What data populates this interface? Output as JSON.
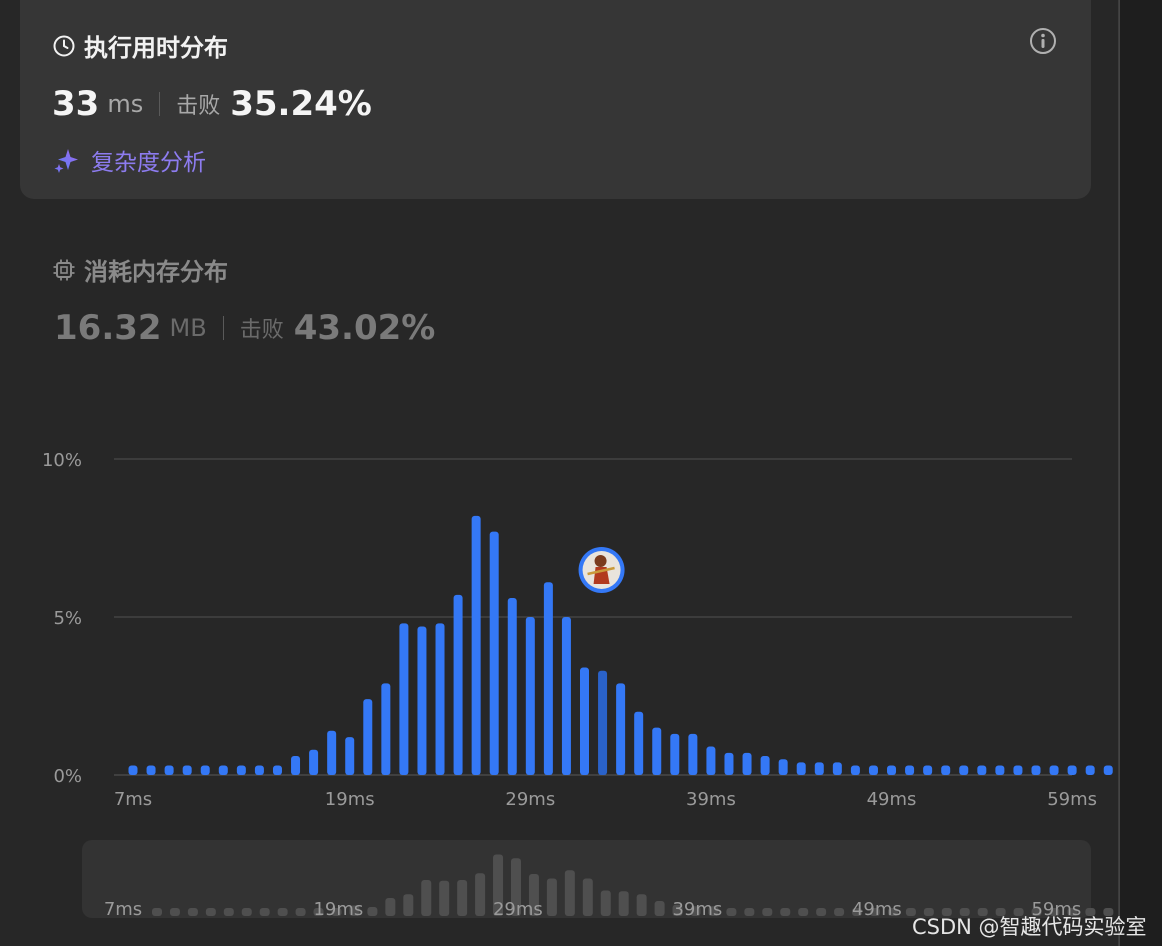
{
  "runtime": {
    "title": "执行用时分布",
    "value": "33",
    "unit": "ms",
    "beat_label": "击败",
    "beat_percent": "35.24%",
    "complexity_link": "复杂度分析"
  },
  "memory": {
    "title": "消耗内存分布",
    "value": "16.32",
    "unit": "MB",
    "beat_label": "击败",
    "beat_percent": "43.02%"
  },
  "colors": {
    "accent": "#3478f6",
    "accent_dim": "#2a62c9",
    "card": "#363636",
    "background": "#272727",
    "link": "#8d7cf0"
  },
  "icons": {
    "runtime_title": "clock-icon",
    "info": "info-icon",
    "complexity": "sparkle-icon",
    "memory_title": "chip-icon",
    "user_marker": "avatar"
  },
  "chart_data": {
    "type": "bar",
    "unit": "%",
    "ylim": [
      0,
      10
    ],
    "y_ticks": [
      "0%",
      "5%",
      "10%"
    ],
    "y_tick_values": [
      0,
      5,
      10
    ],
    "x_tick_labels": [
      "7ms",
      "19ms",
      "29ms",
      "39ms",
      "49ms",
      "59ms"
    ],
    "x_tick_values": [
      7,
      19,
      29,
      39,
      49,
      59
    ],
    "x": [
      7,
      8,
      9,
      10,
      11,
      12,
      13,
      14,
      15,
      16,
      17,
      18,
      19,
      20,
      21,
      22,
      23,
      24,
      25,
      26,
      27,
      28,
      29,
      30,
      31,
      32,
      33,
      34,
      35,
      36,
      37,
      38,
      39,
      40,
      41,
      42,
      43,
      44,
      45,
      46,
      47,
      48,
      49,
      50,
      51,
      52,
      53,
      54,
      55,
      56,
      57,
      58,
      59,
      60,
      61
    ],
    "values": [
      0.3,
      0.3,
      0.3,
      0.3,
      0.3,
      0.3,
      0.3,
      0.3,
      0.3,
      0.6,
      0.8,
      1.4,
      1.2,
      2.4,
      2.9,
      4.8,
      4.7,
      4.8,
      5.7,
      8.2,
      7.7,
      5.6,
      5.0,
      6.1,
      5.0,
      3.4,
      3.3,
      2.9,
      2.0,
      1.5,
      1.3,
      1.3,
      0.9,
      0.7,
      0.7,
      0.6,
      0.5,
      0.4,
      0.4,
      0.4,
      0.3,
      0.3,
      0.3,
      0.3,
      0.3,
      0.3,
      0.3,
      0.3,
      0.3,
      0.3,
      0.3,
      0.3,
      0.3,
      0.3,
      0.3
    ],
    "highlight_x": 33,
    "user_marker_x": 33,
    "grid": true,
    "legend": "none"
  }
}
